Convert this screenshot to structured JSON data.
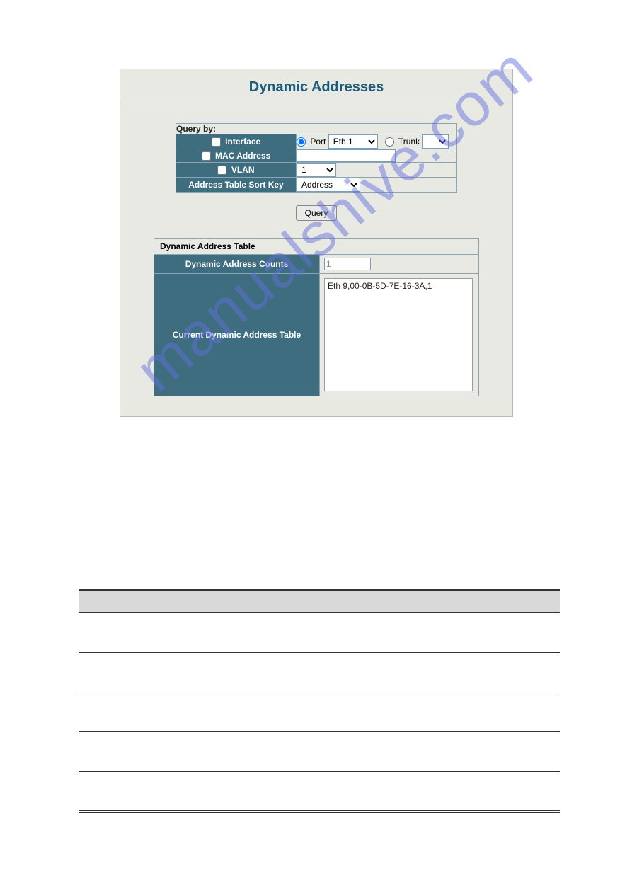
{
  "panel": {
    "title": "Dynamic Addresses",
    "query_by_label": "Query by:",
    "rows": {
      "interface": {
        "label": "Interface",
        "checked": false,
        "port_label": "Port",
        "port_selected": true,
        "port_select_value": "Eth 1",
        "trunk_label": "Trunk",
        "trunk_selected": false,
        "trunk_select_value": ""
      },
      "mac": {
        "label": "MAC Address",
        "checked": false,
        "value": ""
      },
      "vlan": {
        "label": "VLAN",
        "checked": false,
        "select_value": "1"
      },
      "sortkey": {
        "label": "Address Table Sort Key",
        "select_value": "Address"
      }
    },
    "query_button": "Query",
    "table2": {
      "title": "Dynamic Address Table",
      "counts_label": "Dynamic Address Counts",
      "counts_value": "1",
      "current_label": "Current Dynamic Address Table",
      "entries": [
        "Eth 9,00-0B-5D-7E-16-3A,1"
      ]
    }
  },
  "watermark_text": "manualshive.com"
}
